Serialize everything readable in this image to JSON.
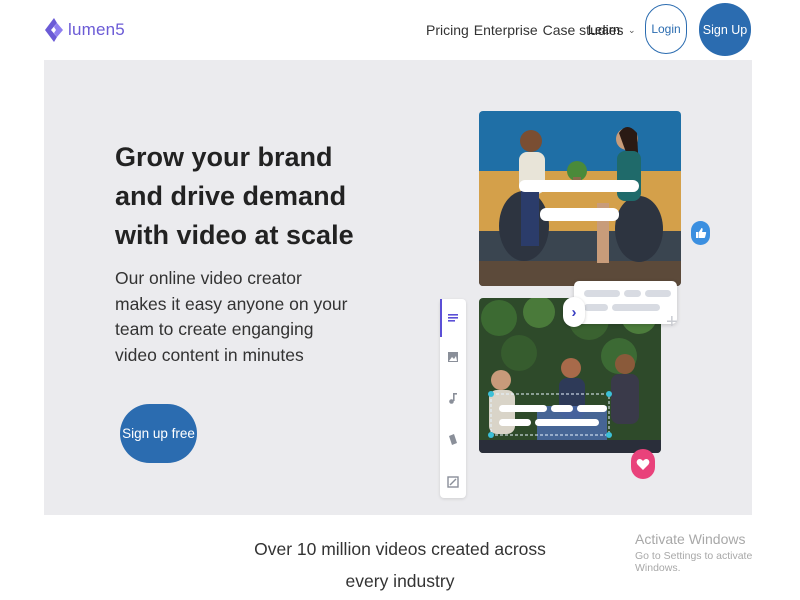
{
  "brand": {
    "name": "lumen5",
    "color": "#6b5bd6"
  },
  "nav": {
    "items": [
      "Pricing",
      "Enterprise",
      "Case studies"
    ],
    "learn_label": "Learn",
    "login_label": "Login",
    "signup_label": "Sign Up"
  },
  "hero": {
    "title": "Grow your brand and drive demand with video at scale",
    "subtitle": "Our online video creator makes it easy anyone on your team to create enganging video content in minutes",
    "cta_label": "Sign up free"
  },
  "stats": {
    "text": "Over 10 million videos created across every industry"
  },
  "watermark": {
    "title": "Activate Windows",
    "subtitle": "Go to Settings to activate Windows."
  },
  "icons": {
    "toolbar": [
      "text-icon",
      "image-icon",
      "music-icon",
      "brand-icon",
      "resize-icon"
    ],
    "badges": [
      "thumbs-up-icon",
      "heart-icon"
    ]
  },
  "colors": {
    "primary": "#2b6cb0",
    "hero_bg": "#ebebee",
    "toolbar_accent": "#5b4fd6",
    "like": "#3b8fe0",
    "heart": "#e9427b"
  }
}
